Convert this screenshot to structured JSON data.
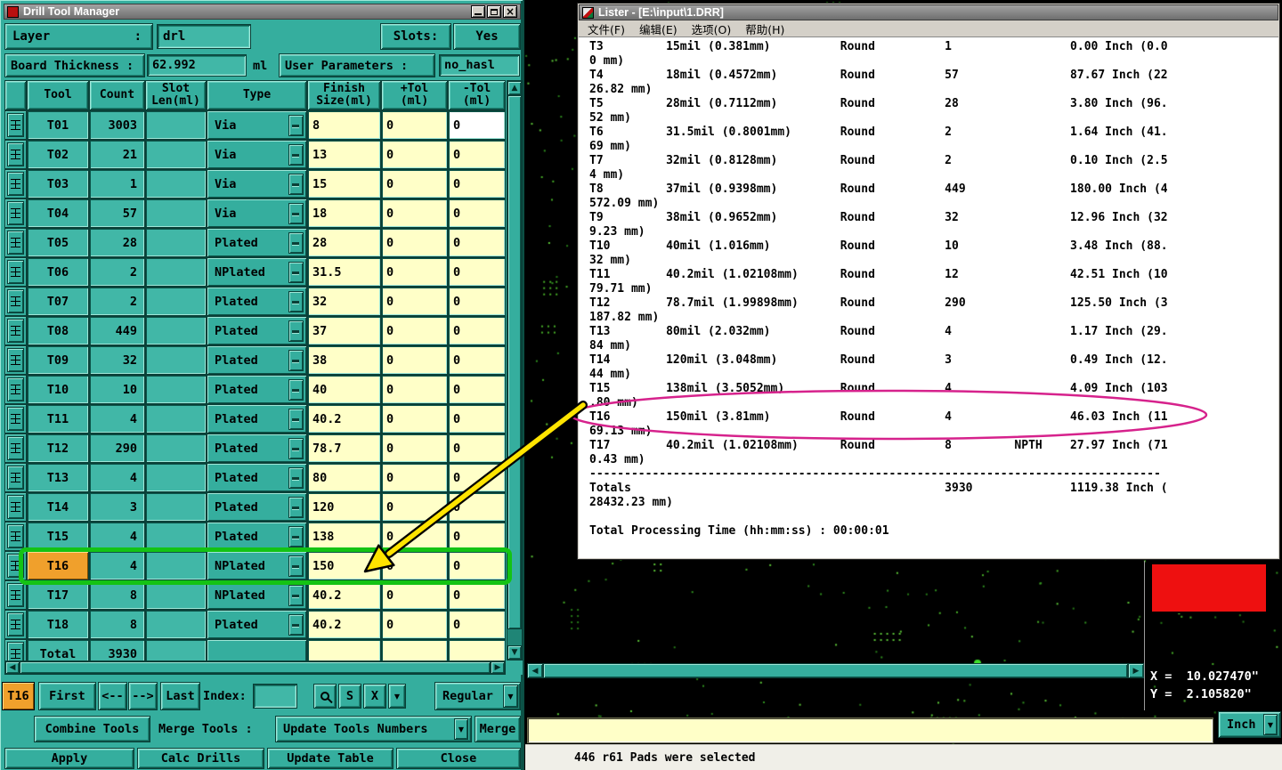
{
  "window": {
    "title": "Drill Tool Manager"
  },
  "fields": {
    "layer_label": "Layer",
    "layer_colon": ":",
    "layer_value": "drl",
    "slots_label": "Slots:",
    "slots_value": "Yes",
    "board_thickness_label": "Board Thickness :",
    "board_thickness_value": "62.992",
    "board_thickness_unit": "ml",
    "user_parameters_label": "User Parameters :",
    "user_parameters_value": "no_hasl"
  },
  "drill_table": {
    "headers": [
      "Tool",
      "Count",
      "Slot\nLen(ml)",
      "Type",
      "Finish\nSize(ml)",
      "+Tol\n(ml)",
      "-Tol\n(ml)"
    ],
    "rows": [
      {
        "tool": "T01",
        "count": "3003",
        "slot": "",
        "type": "Via",
        "finish": "8",
        "ptol": "0",
        "ntol": "0"
      },
      {
        "tool": "T02",
        "count": "21",
        "slot": "",
        "type": "Via",
        "finish": "13",
        "ptol": "0",
        "ntol": "0"
      },
      {
        "tool": "T03",
        "count": "1",
        "slot": "",
        "type": "Via",
        "finish": "15",
        "ptol": "0",
        "ntol": "0"
      },
      {
        "tool": "T04",
        "count": "57",
        "slot": "",
        "type": "Via",
        "finish": "18",
        "ptol": "0",
        "ntol": "0"
      },
      {
        "tool": "T05",
        "count": "28",
        "slot": "",
        "type": "Plated",
        "finish": "28",
        "ptol": "0",
        "ntol": "0"
      },
      {
        "tool": "T06",
        "count": "2",
        "slot": "",
        "type": "NPlated",
        "finish": "31.5",
        "ptol": "0",
        "ntol": "0"
      },
      {
        "tool": "T07",
        "count": "2",
        "slot": "",
        "type": "Plated",
        "finish": "32",
        "ptol": "0",
        "ntol": "0"
      },
      {
        "tool": "T08",
        "count": "449",
        "slot": "",
        "type": "Plated",
        "finish": "37",
        "ptol": "0",
        "ntol": "0"
      },
      {
        "tool": "T09",
        "count": "32",
        "slot": "",
        "type": "Plated",
        "finish": "38",
        "ptol": "0",
        "ntol": "0"
      },
      {
        "tool": "T10",
        "count": "10",
        "slot": "",
        "type": "Plated",
        "finish": "40",
        "ptol": "0",
        "ntol": "0"
      },
      {
        "tool": "T11",
        "count": "4",
        "slot": "",
        "type": "Plated",
        "finish": "40.2",
        "ptol": "0",
        "ntol": "0"
      },
      {
        "tool": "T12",
        "count": "290",
        "slot": "",
        "type": "Plated",
        "finish": "78.7",
        "ptol": "0",
        "ntol": "0"
      },
      {
        "tool": "T13",
        "count": "4",
        "slot": "",
        "type": "Plated",
        "finish": "80",
        "ptol": "0",
        "ntol": "0"
      },
      {
        "tool": "T14",
        "count": "3",
        "slot": "",
        "type": "Plated",
        "finish": "120",
        "ptol": "0",
        "ntol": "0"
      },
      {
        "tool": "T15",
        "count": "4",
        "slot": "",
        "type": "Plated",
        "finish": "138",
        "ptol": "0",
        "ntol": "0"
      },
      {
        "tool": "T16",
        "count": "4",
        "slot": "",
        "type": "NPlated",
        "finish": "150",
        "ptol": "0",
        "ntol": "0",
        "selected": true
      },
      {
        "tool": "T17",
        "count": "8",
        "slot": "",
        "type": "NPlated",
        "finish": "40.2",
        "ptol": "0",
        "ntol": "0"
      },
      {
        "tool": "T18",
        "count": "8",
        "slot": "",
        "type": "Plated",
        "finish": "40.2",
        "ptol": "0",
        "ntol": "0"
      }
    ],
    "total_label": "Total",
    "total_count": "3930"
  },
  "nav": {
    "current_tool": "T16",
    "first": "First",
    "prev": "<--",
    "next": "-->",
    "last": "Last",
    "index_label": "Index:",
    "index_value": "",
    "mode": "Regular"
  },
  "actions": {
    "combine_tools": "Combine Tools",
    "merge_tools_label": "Merge Tools :",
    "update_tools_numbers": "Update Tools Numbers",
    "merge": "Merge",
    "apply": "Apply",
    "calc_drills": "Calc Drills",
    "update_table": "Update Table",
    "close": "Close"
  },
  "lister": {
    "title": "Lister - [E:\\input\\1.DRR]",
    "menu": [
      "文件(F)",
      "编辑(E)",
      "选项(O)",
      "帮助(H)"
    ],
    "entries": [
      {
        "tool": "T3",
        "size": "15mil (0.381mm)",
        "shape": "Round",
        "count": "1",
        "length": "0.00 Inch (0.0",
        "cont": "0 mm)"
      },
      {
        "tool": "T4",
        "size": "18mil (0.4572mm)",
        "shape": "Round",
        "count": "57",
        "length": "87.67 Inch (22",
        "cont": "26.82 mm)"
      },
      {
        "tool": "T5",
        "size": "28mil (0.7112mm)",
        "shape": "Round",
        "count": "28",
        "length": "3.80 Inch (96.",
        "cont": "52 mm)"
      },
      {
        "tool": "T6",
        "size": "31.5mil (0.8001mm)",
        "shape": "Round",
        "count": "2",
        "length": "1.64 Inch (41.",
        "cont": "69 mm)"
      },
      {
        "tool": "T7",
        "size": "32mil (0.8128mm)",
        "shape": "Round",
        "count": "2",
        "length": "0.10 Inch (2.5",
        "cont": "4 mm)"
      },
      {
        "tool": "T8",
        "size": "37mil (0.9398mm)",
        "shape": "Round",
        "count": "449",
        "length": "180.00 Inch (4",
        "cont": "572.09 mm)"
      },
      {
        "tool": "T9",
        "size": "38mil (0.9652mm)",
        "shape": "Round",
        "count": "32",
        "length": "12.96 Inch (32",
        "cont": "9.23 mm)"
      },
      {
        "tool": "T10",
        "size": "40mil (1.016mm)",
        "shape": "Round",
        "count": "10",
        "length": "3.48 Inch (88.",
        "cont": "32 mm)"
      },
      {
        "tool": "T11",
        "size": "40.2mil (1.02108mm)",
        "shape": "Round",
        "count": "12",
        "length": "42.51 Inch (10",
        "cont": "79.71 mm)"
      },
      {
        "tool": "T12",
        "size": "78.7mil (1.99898mm)",
        "shape": "Round",
        "count": "290",
        "length": "125.50 Inch (3",
        "cont": "187.82 mm)"
      },
      {
        "tool": "T13",
        "size": "80mil (2.032mm)",
        "shape": "Round",
        "count": "4",
        "length": "1.17 Inch (29.",
        "cont": "84 mm)"
      },
      {
        "tool": "T14",
        "size": "120mil (3.048mm)",
        "shape": "Round",
        "count": "3",
        "length": "0.49 Inch (12.",
        "cont": "44 mm)"
      },
      {
        "tool": "T15",
        "size": "138mil (3.5052mm)",
        "shape": "Round",
        "count": "4",
        "length": "4.09 Inch (103",
        "cont": ".80 mm)"
      },
      {
        "tool": "T16",
        "size": "150mil (3.81mm)",
        "shape": "Round",
        "count": "4",
        "length": "46.03 Inch (11",
        "cont": "69.13 mm)"
      },
      {
        "tool": "T17",
        "size": "40.2mil (1.02108mm)",
        "shape": "Round",
        "count": "8",
        "npth": "NPTH",
        "length": "27.97 Inch (71",
        "cont": "0.43 mm)"
      }
    ],
    "separator": "----------------------------------------------------------------------------------",
    "totals": {
      "label": "Totals",
      "count": "3930",
      "length": "1119.38 Inch (",
      "cont": "28432.23 mm)"
    },
    "processing_time": "Total Processing Time (hh:mm:ss) : 00:00:01"
  },
  "canvas": {
    "coords_x": "X =  10.027470\"",
    "coords_y": "Y =  2.105820\"",
    "units": "Inch"
  },
  "status_bar": {
    "message": "446 r61 Pads were selected"
  },
  "colors": {
    "teal": "#35ae9e",
    "cream": "#ffffc8",
    "orange": "#f0a02c",
    "annotation_green": "#14c314",
    "annotation_magenta": "#d6228c",
    "arrow_yellow": "#ffe400",
    "selection_red": "#ee1010",
    "dot_green": "#46ad27"
  }
}
